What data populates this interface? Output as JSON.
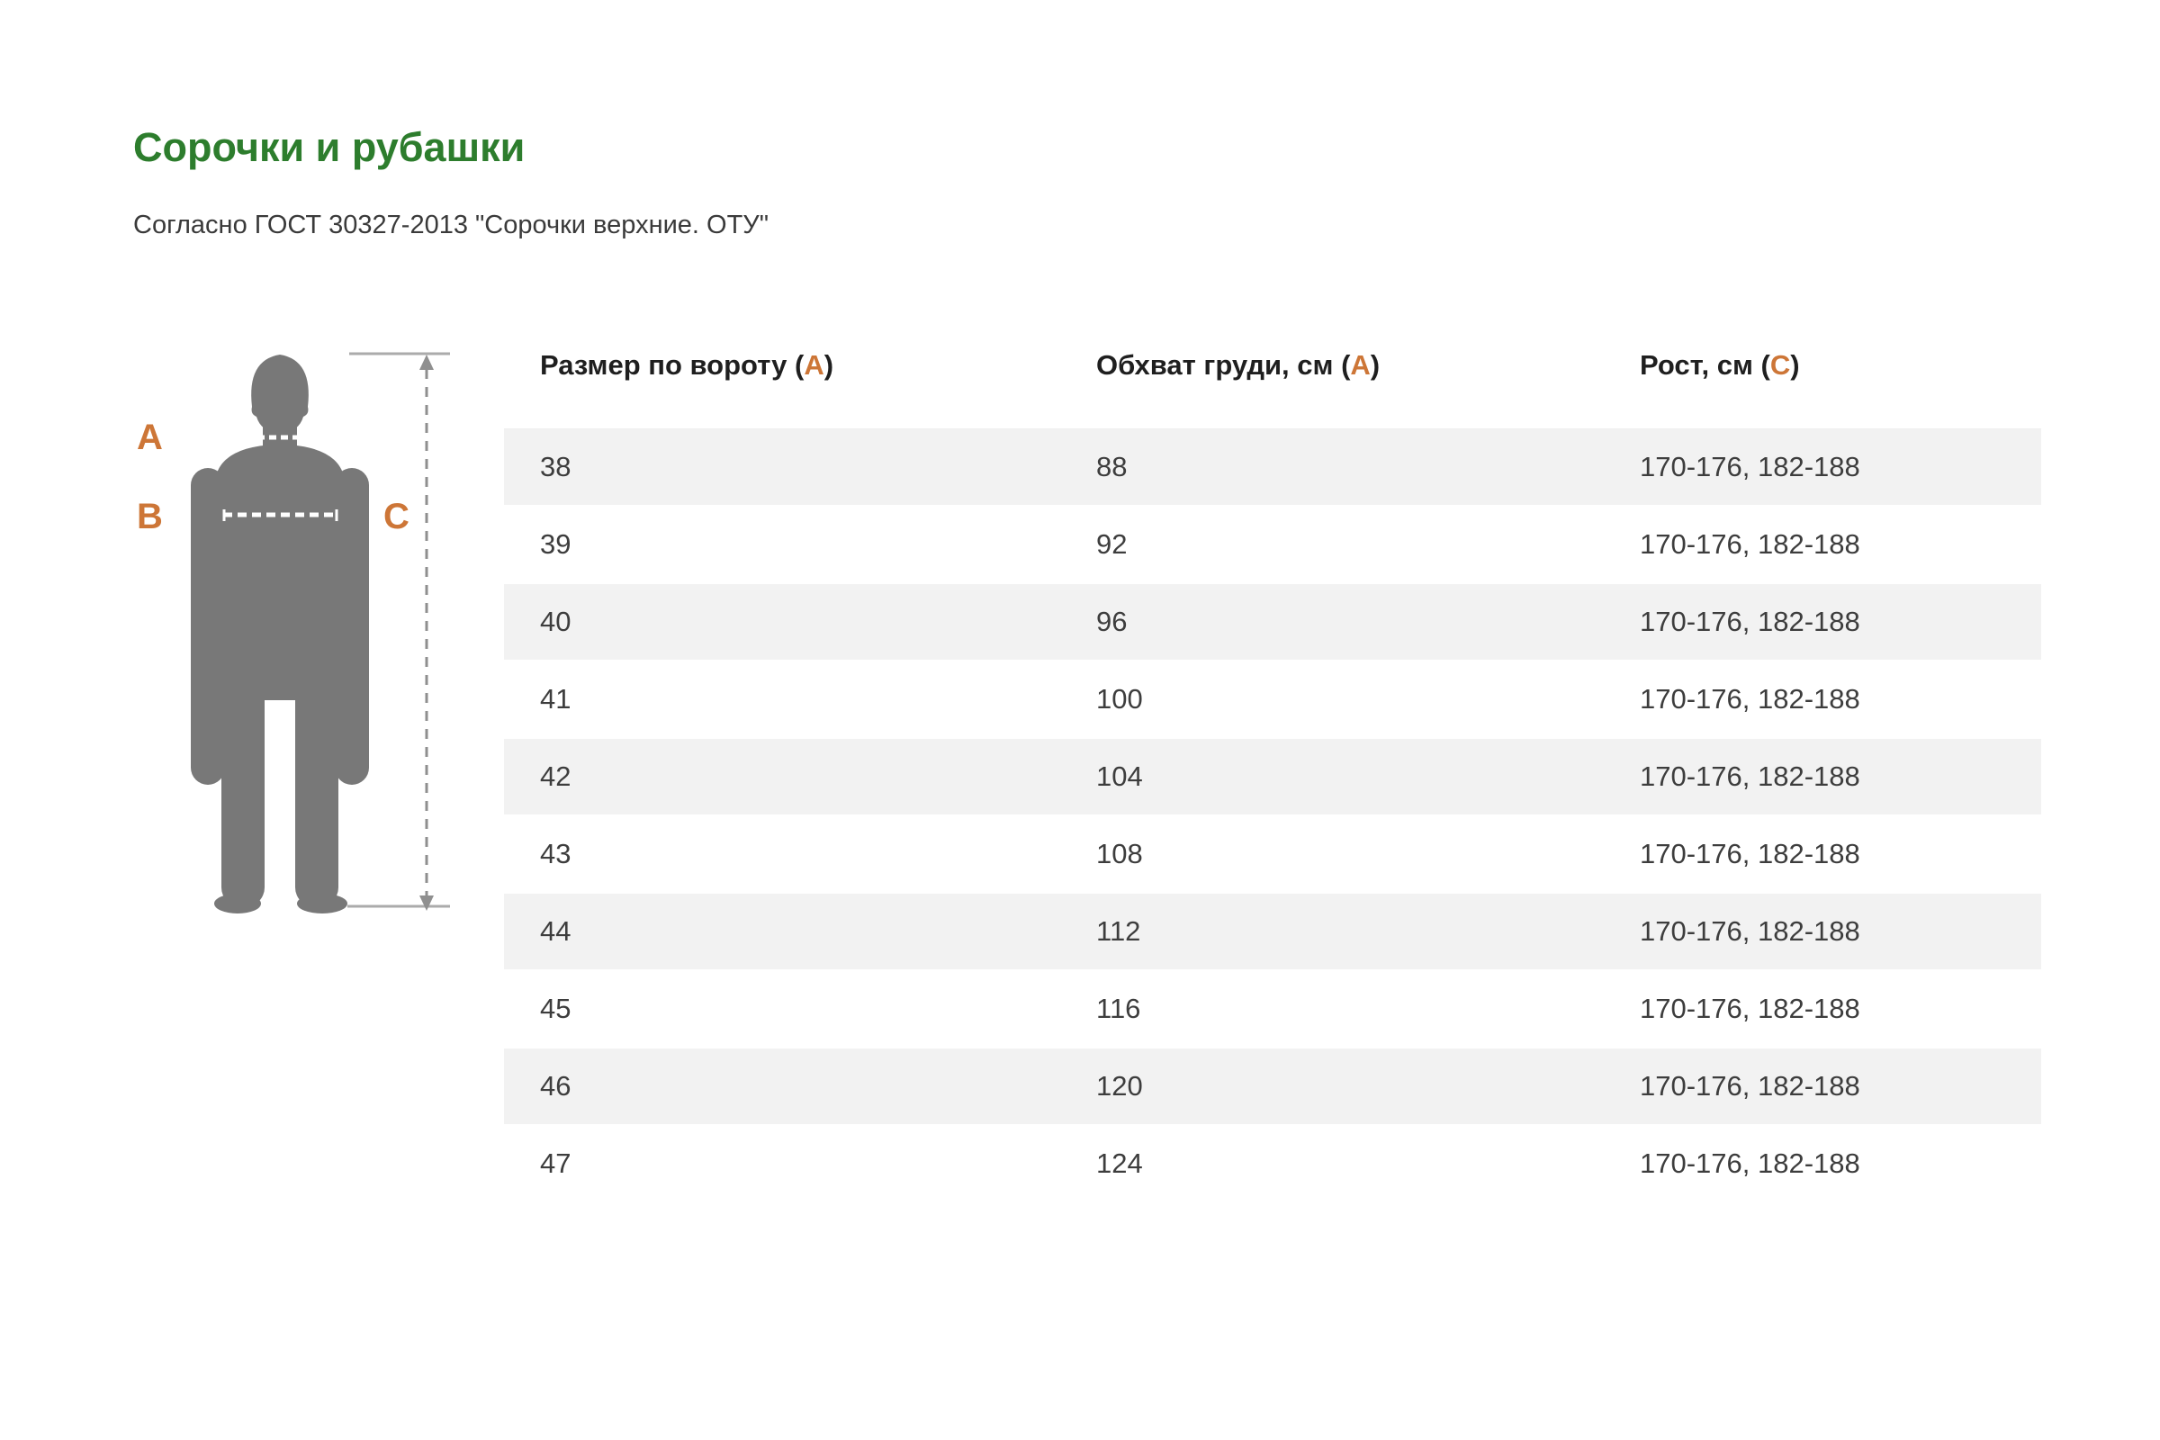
{
  "page": {
    "title": "Сорочки и рубашки",
    "subtitle": "Согласно ГОСТ 30327-2013 \"Сорочки верхние. ОТУ\""
  },
  "figure": {
    "label_a": "A",
    "label_b": "B",
    "label_c": "C"
  },
  "table": {
    "headers": [
      {
        "prefix": "Размер по вороту (",
        "letter": "А",
        "suffix": ")"
      },
      {
        "prefix": "Обхват груди, см (",
        "letter": "А",
        "suffix": ")"
      },
      {
        "prefix": "Рост, см (",
        "letter": "С",
        "suffix": ")"
      }
    ],
    "rows": [
      {
        "size": "38",
        "chest": "88",
        "height": "170-176, 182-188"
      },
      {
        "size": "39",
        "chest": "92",
        "height": "170-176, 182-188"
      },
      {
        "size": "40",
        "chest": "96",
        "height": "170-176, 182-188"
      },
      {
        "size": "41",
        "chest": "100",
        "height": "170-176, 182-188"
      },
      {
        "size": "42",
        "chest": "104",
        "height": "170-176, 182-188"
      },
      {
        "size": "43",
        "chest": "108",
        "height": "170-176, 182-188"
      },
      {
        "size": "44",
        "chest": "112",
        "height": "170-176, 182-188"
      },
      {
        "size": "45",
        "chest": "116",
        "height": "170-176, 182-188"
      },
      {
        "size": "46",
        "chest": "120",
        "height": "170-176, 182-188"
      },
      {
        "size": "47",
        "chest": "124",
        "height": "170-176, 182-188"
      }
    ]
  },
  "colors": {
    "accent_green": "#2d7d2d",
    "accent_orange": "#cd7637",
    "silhouette_gray": "#787878",
    "stripe_gray": "#f2f2f2",
    "measure_line_gray": "#9e9e9e"
  }
}
